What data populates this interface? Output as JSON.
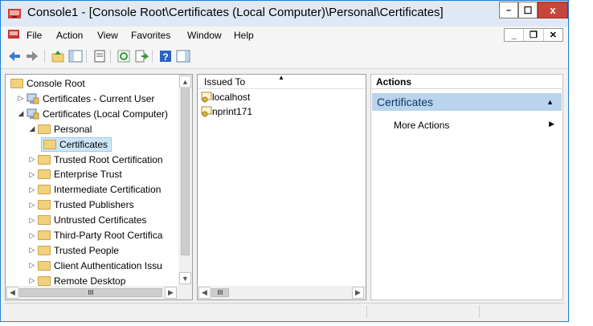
{
  "window": {
    "title": "Console1 - [Console Root\\Certificates (Local Computer)\\Personal\\Certificates]",
    "controls": {
      "minimize": "–",
      "maximize": "☐",
      "close": "x"
    }
  },
  "menubar": {
    "items": [
      "File",
      "Action",
      "View",
      "Favorites",
      "Window",
      "Help"
    ],
    "mdi": {
      "minimize": "_",
      "restore": "❐",
      "close": "✕"
    }
  },
  "tree": {
    "items": [
      {
        "label": "Console Root",
        "arrow": "",
        "icon": "folder"
      },
      {
        "label": "Certificates - Current User",
        "arrow": "▷",
        "icon": "certstore"
      },
      {
        "label": "Certificates (Local Computer)",
        "arrow": "◢",
        "icon": "certstore"
      },
      {
        "label": "Personal",
        "arrow": "◢",
        "icon": "folder"
      },
      {
        "label": "Certificates",
        "arrow": "",
        "icon": "folder",
        "selected": true
      },
      {
        "label": "Trusted Root Certification",
        "arrow": "▷",
        "icon": "folder"
      },
      {
        "label": "Enterprise Trust",
        "arrow": "▷",
        "icon": "folder"
      },
      {
        "label": "Intermediate Certification",
        "arrow": "▷",
        "icon": "folder"
      },
      {
        "label": "Trusted Publishers",
        "arrow": "▷",
        "icon": "folder"
      },
      {
        "label": "Untrusted Certificates",
        "arrow": "▷",
        "icon": "folder"
      },
      {
        "label": "Third-Party Root Certifica",
        "arrow": "▷",
        "icon": "folder"
      },
      {
        "label": "Trusted People",
        "arrow": "▷",
        "icon": "folder"
      },
      {
        "label": "Client Authentication Issu",
        "arrow": "▷",
        "icon": "folder"
      },
      {
        "label": "Remote Desktop",
        "arrow": "▷",
        "icon": "folder"
      }
    ],
    "hscroll_mid": "III"
  },
  "list": {
    "column_header": "Issued To",
    "sort_indicator": "▲",
    "rows": [
      "localhost",
      "nprint171"
    ],
    "hscroll_mid": "III"
  },
  "actions": {
    "header": "Actions",
    "section": "Certificates",
    "section_arrow": "▲",
    "items": [
      {
        "label": "More Actions",
        "arrow": "▶"
      }
    ]
  }
}
